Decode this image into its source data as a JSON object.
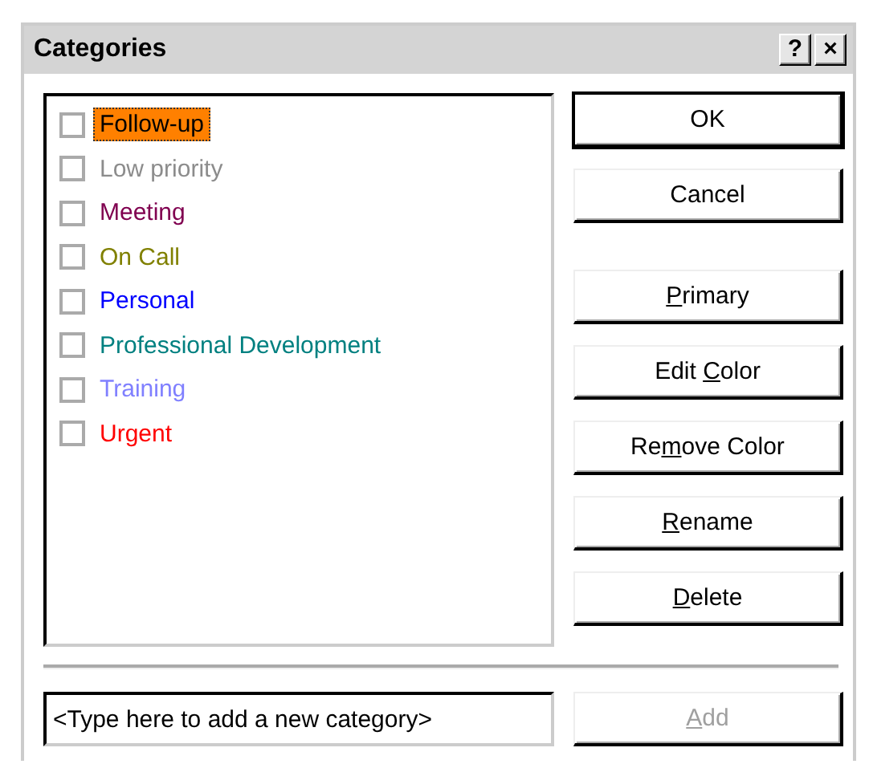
{
  "window": {
    "title": "Categories",
    "title_buttons": [
      "?",
      "×"
    ]
  },
  "categories": [
    {
      "label": "Follow-up",
      "checked": false,
      "selected": true
    },
    {
      "label": "Low priority",
      "color": "#8c8c8c",
      "checked": false,
      "selected": false
    },
    {
      "label": "Meeting",
      "color": "#800050",
      "checked": false,
      "selected": false
    },
    {
      "label": "On Call",
      "color": "#808000",
      "checked": false,
      "selected": false
    },
    {
      "label": "Personal",
      "color": "#0000ff",
      "checked": false,
      "selected": false
    },
    {
      "label": "Professional Development",
      "color": "#008080",
      "checked": false,
      "selected": false
    },
    {
      "label": "Training",
      "color": "#8080ff",
      "checked": false,
      "selected": false
    },
    {
      "label": "Urgent",
      "color": "#ff0000",
      "checked": false,
      "selected": false
    }
  ],
  "buttons": [
    {
      "label": [
        {
          "text": "OK",
          "underlined": false
        }
      ],
      "default": true,
      "disabled": false
    },
    {
      "label": [
        {
          "text": "Cancel",
          "underlined": false
        }
      ],
      "default": false,
      "disabled": false
    },
    {
      "label": [
        {
          "text": "P",
          "underlined": true
        },
        {
          "text": "rimary",
          "underlined": false
        }
      ],
      "default": false,
      "disabled": false
    },
    {
      "label": [
        {
          "text": "Edit ",
          "underlined": false
        },
        {
          "text": "C",
          "underlined": true
        },
        {
          "text": "olor",
          "underlined": false
        }
      ],
      "default": false,
      "disabled": false
    },
    {
      "label": [
        {
          "text": "Re",
          "underlined": false
        },
        {
          "text": "m",
          "underlined": true
        },
        {
          "text": "ove Color",
          "underlined": false
        }
      ],
      "default": false,
      "disabled": false
    },
    {
      "label": [
        {
          "text": "R",
          "underlined": true
        },
        {
          "text": "ename",
          "underlined": false
        }
      ],
      "default": false,
      "disabled": false
    },
    {
      "label": [
        {
          "text": "D",
          "underlined": true
        },
        {
          "text": "elete",
          "underlined": false
        }
      ],
      "default": false,
      "disabled": false
    }
  ],
  "new_category": {
    "value": "<Type here to add a new category>"
  },
  "add_button": {
    "label": [
      {
        "text": "A",
        "underlined": true
      },
      {
        "text": "dd",
        "underlined": false
      }
    ],
    "disabled": true
  }
}
